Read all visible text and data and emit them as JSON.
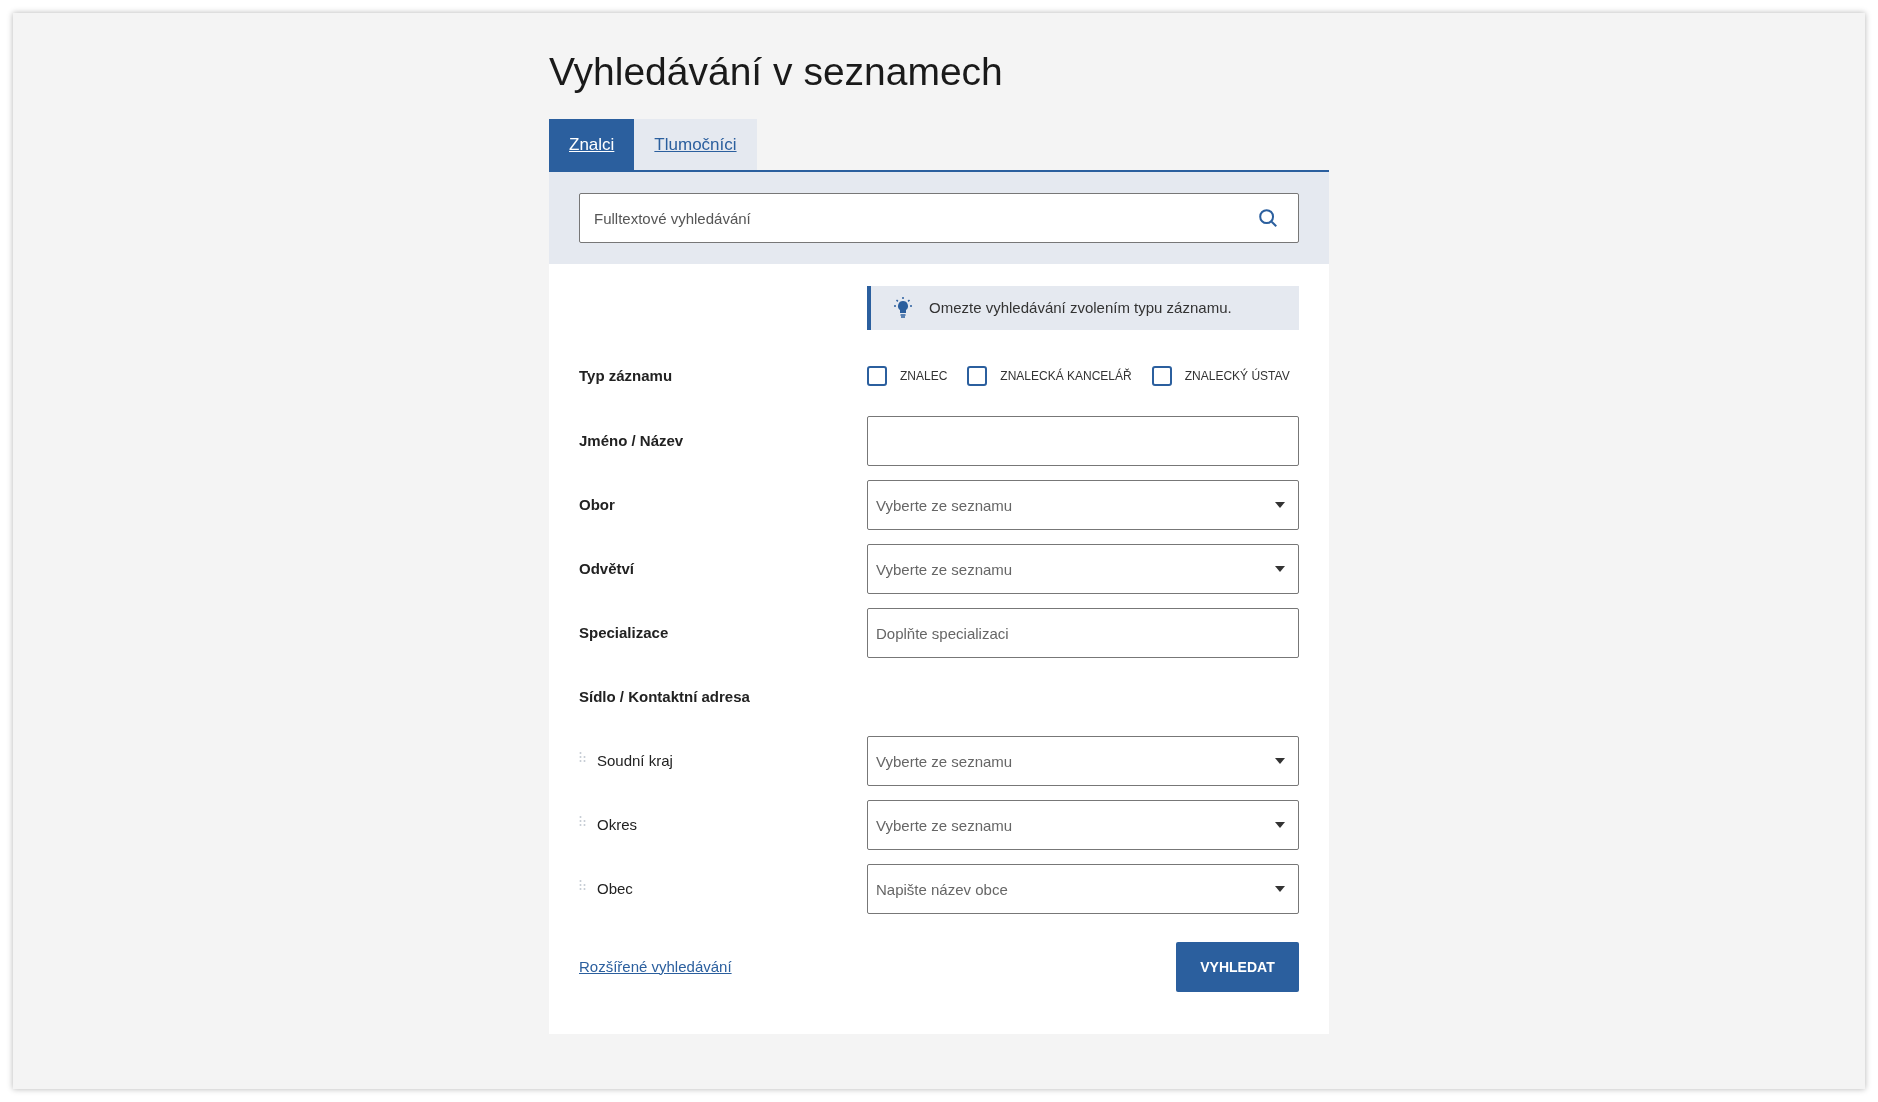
{
  "title": "Vyhledávání v seznamech",
  "tabs": [
    {
      "label": "Znalci",
      "selected": true
    },
    {
      "label": "Tlumočníci",
      "selected": false
    }
  ],
  "search": {
    "placeholder": "Fulltextové vyhledávání"
  },
  "hint": "Omezte vyhledávání zvolením typu záznamu.",
  "record_type": {
    "label": "Typ záznamu",
    "options": [
      {
        "label": "ZNALEC",
        "checked": false
      },
      {
        "label": "ZNALECKÁ KANCELÁŘ",
        "checked": false
      },
      {
        "label": "ZNALECKÝ ÚSTAV",
        "checked": false
      }
    ]
  },
  "fields": [
    {
      "label": "Jméno / Název",
      "kind": "text",
      "sub": false
    },
    {
      "label": "Obor",
      "kind": "select",
      "placeholder": "Vyberte ze seznamu",
      "sub": false
    },
    {
      "label": "Odvětví",
      "kind": "select",
      "placeholder": "Vyberte ze seznamu",
      "sub": false
    },
    {
      "label": "Specializace",
      "kind": "text",
      "placeholder": "Doplňte specializaci",
      "sub": false
    },
    {
      "label": "Sídlo / Kontaktní adresa",
      "kind": "heading",
      "sub": false
    },
    {
      "label": "Soudní kraj",
      "kind": "select",
      "placeholder": "Vyberte ze seznamu",
      "sub": true
    },
    {
      "label": "Okres",
      "kind": "select",
      "placeholder": "Vyberte ze seznamu",
      "sub": true
    },
    {
      "label": "Obec",
      "kind": "select",
      "placeholder": "Napište název obce",
      "sub": true
    }
  ],
  "advanced_link": "Rozšířené vyhledávání",
  "submit": "VYHLEDAT"
}
